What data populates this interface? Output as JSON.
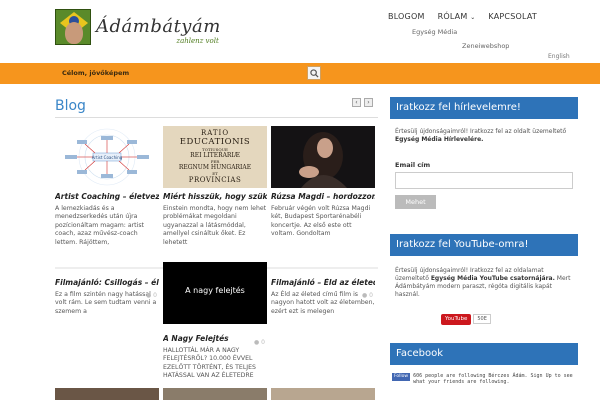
{
  "header": {
    "logo_title": "Ádámbátyám",
    "logo_sub": "zahlenz volt",
    "nav": [
      {
        "label": "BLOGOM"
      },
      {
        "label": "RÓLAM",
        "caret": "⌄"
      },
      {
        "label": "KAPCSOLAT"
      }
    ],
    "subnav_1": "Egység Média",
    "subnav_2": "Zeneiwebshop",
    "language": "English"
  },
  "bar": {
    "menu_item": "Célom, jövőképem",
    "search_icon": "search-icon"
  },
  "blog": {
    "title": "Blog",
    "prev": "‹",
    "next": "›",
    "posts": [
      {
        "title": "Artist Coaching – életveze...",
        "excerpt": "A lemezkiadás és a menedzserkedés után új̀ra pozícionáltam magam: artist coach, azaz művész-coach lettem. Rájöttem,",
        "thumb_labels": [
          "Artist Coaching"
        ]
      },
      {
        "title": "Miért hisszük, hogy szüksé...",
        "excerpt": "Einstein mondta, hogy nem lehet problémákat megoldani ugyanazzal a látásmóddal, amellyel csináltuk őket. Ez lehetett",
        "thumb_lines": [
          "RATIO",
          "EDUCATIONIS",
          "TOTIUSQUE",
          "REI LITERARIÆ",
          "PER",
          "REGNUM HUNGARIAE",
          "ET",
          "PROVINCIAS"
        ]
      },
      {
        "title": "Rúzsa Magdi – hordozzon ...",
        "excerpt": "Február végén volt Rúzsa Magdi két, Budapest Sportarénabéli koncertje. Az első este ott voltam. Gondoltam"
      },
      {
        "title": "Filmajánló: Csillogás – éle...",
        "excerpt": "Ez a film szintén nagy hatással volt rám. Le sem tudtam venni a szemem a"
      },
      {
        "title": "A Nagy Felejtés",
        "excerpt": "HALLOTTÁL MÁR A NAGY FELEJTÉSRŐL? 10.000 ÉVVEL EZELŐTT TÖRTÉNT, ÉS TELJES HATÁSSAL VAN AZ ÉLETEDRE",
        "thumb_text": "A nagy felejtés"
      },
      {
        "title": "Filmajánló – Éld az életed",
        "excerpt": "Az Éld az életed című film is nagyon hatott volt az életemben, ezért ezt is melegen"
      }
    ],
    "comment_icon": "comment-icon"
  },
  "sidebar": {
    "newsletter_title": "Iratkozz fel hírlevelemre!",
    "newsletter_text_1": "Értesülj újdonságaimról! Iratkozz fel az oldalt üzemeltető ",
    "newsletter_text_bold": "Egység Média Hírlevelére.",
    "email_label": "Email cím",
    "email_value": "",
    "send_label": "Mehet",
    "youtube_title": "Iratkozz fel YouTube-omra!",
    "youtube_text_1": "Értesülj újdonságaimról! Iratkozz fel az oldalamat üzemeltető ",
    "youtube_text_bold": "Egység Média YouTube csatornájára.",
    "youtube_text_2": " Mert Ádámbátyám modern paraszt, régóta digitális kapát használ.",
    "youtube_button": "YouTube",
    "youtube_count": "50E",
    "facebook_title": "Facebook",
    "facebook_follow": "Follow",
    "facebook_line": "606 people are following Bérczes Ádám. Sign Up to see what your friends are following."
  },
  "colors": {
    "accent": "#2e73b8",
    "orange": "#f6951d",
    "blog_title": "#3a86c8"
  }
}
